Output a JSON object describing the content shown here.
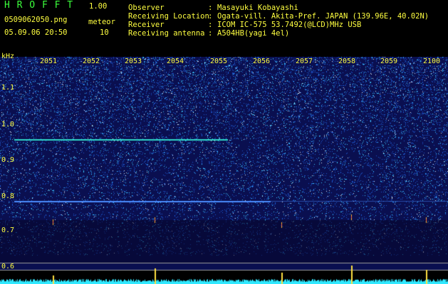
{
  "app": {
    "name": "H R O F F T",
    "version": "1.00",
    "filename": "0509062050.png",
    "datetime": "05.09.06 20:50",
    "mode_label": "meteor",
    "meteor_count": "10"
  },
  "info": {
    "rows": [
      {
        "label": "Observer",
        "value": "Masayuki Kobayashi"
      },
      {
        "label": "Receiving Location",
        "value": "Ogata-vill. Akita-Pref. JAPAN (139.96E, 40.02N)"
      },
      {
        "label": "Receiver",
        "value": "ICOM IC-575 53.7492(@LCD)MHz USB"
      },
      {
        "label": "Receiving antenna",
        "value": "A504HB(yagi 4el)"
      }
    ]
  },
  "chart_data": {
    "type": "heatmap",
    "ylabel": "kHz",
    "y_ticks": [
      "1.1",
      "1.0",
      "0.9",
      "0.8",
      "0.7",
      "0.6"
    ],
    "time_ticks": [
      "2051",
      "2052",
      "2053",
      "2054",
      "2055",
      "2056",
      "2057",
      "2058",
      "2059",
      "2100"
    ],
    "colors": {
      "background": "#0a0f50",
      "signal": "#4fe0ff",
      "trace": "#30e8ff",
      "label": "#ffff40",
      "header_green": "#3cff3c"
    }
  }
}
